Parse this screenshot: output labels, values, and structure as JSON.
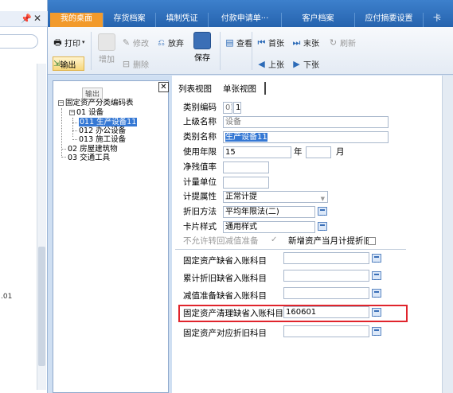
{
  "nav": {
    "truncated_text": ".01"
  },
  "tabs": [
    {
      "label": "我的桌面",
      "active": true
    },
    {
      "label": "存货档案",
      "active": false
    },
    {
      "label": "填制凭证",
      "active": false
    },
    {
      "label": "付款申请单···",
      "active": false
    },
    {
      "label": "客户档案",
      "active": false
    },
    {
      "label": "应付摘要设置",
      "active": false
    },
    {
      "label": "卡",
      "active": false
    }
  ],
  "toolbar": {
    "print": "打印",
    "output": "输出",
    "add": "增加",
    "edit": "修改",
    "delete": "删除",
    "abandon": "放弃",
    "save": "保存",
    "view": "查看",
    "first": "首张",
    "last": "末张",
    "prev": "上张",
    "next": "下张",
    "refresh": "刷新"
  },
  "tree": {
    "tooltip": "输出",
    "nodes": [
      {
        "text": "固定资产分类编码表",
        "toggle": "−"
      },
      {
        "text": "01  设备",
        "toggle": "−"
      },
      {
        "text": "011  生产设备11",
        "selected": true
      },
      {
        "text": "012  办公设备"
      },
      {
        "text": "013  施工设备"
      },
      {
        "text": "02  房屋建筑物",
        "toggle": ""
      },
      {
        "text": "03  交通工具"
      }
    ]
  },
  "form": {
    "view_tabs": [
      "列表视图",
      "单张视图"
    ],
    "category_code_label": "类别编码",
    "category_code_parts": [
      "01",
      "1"
    ],
    "parent_name_label": "上级名称",
    "parent_name_value": "设备",
    "category_name_label": "类别名称",
    "category_name_value": "生产设备11",
    "useful_life_label": "使用年限",
    "useful_life_years": "15",
    "year_unit": "年",
    "month_unit": "月",
    "net_residual_label": "净残值率",
    "unit_label": "计量单位",
    "depr_attr_label": "计提属性",
    "depr_attr_value": "正常计提",
    "depr_method_label": "折旧方法",
    "depr_method_value": "平均年限法(二)",
    "card_style_label": "卡片样式",
    "card_style_value": "通用样式",
    "no_reverse_label": "不允许转回减值准备",
    "new_asset_label": "新增资产当月计提折旧",
    "default_asset_account_label": "固定资产缺省入账科目",
    "default_accum_depr_label": "累计折旧缺省入账科目",
    "default_impair_label": "减值准备缺省入账科目",
    "default_disposal_label": "固定资产清理缺省入账科目",
    "default_disposal_value": "160601",
    "corresponding_depr_label": "固定资产对应折旧科目"
  }
}
